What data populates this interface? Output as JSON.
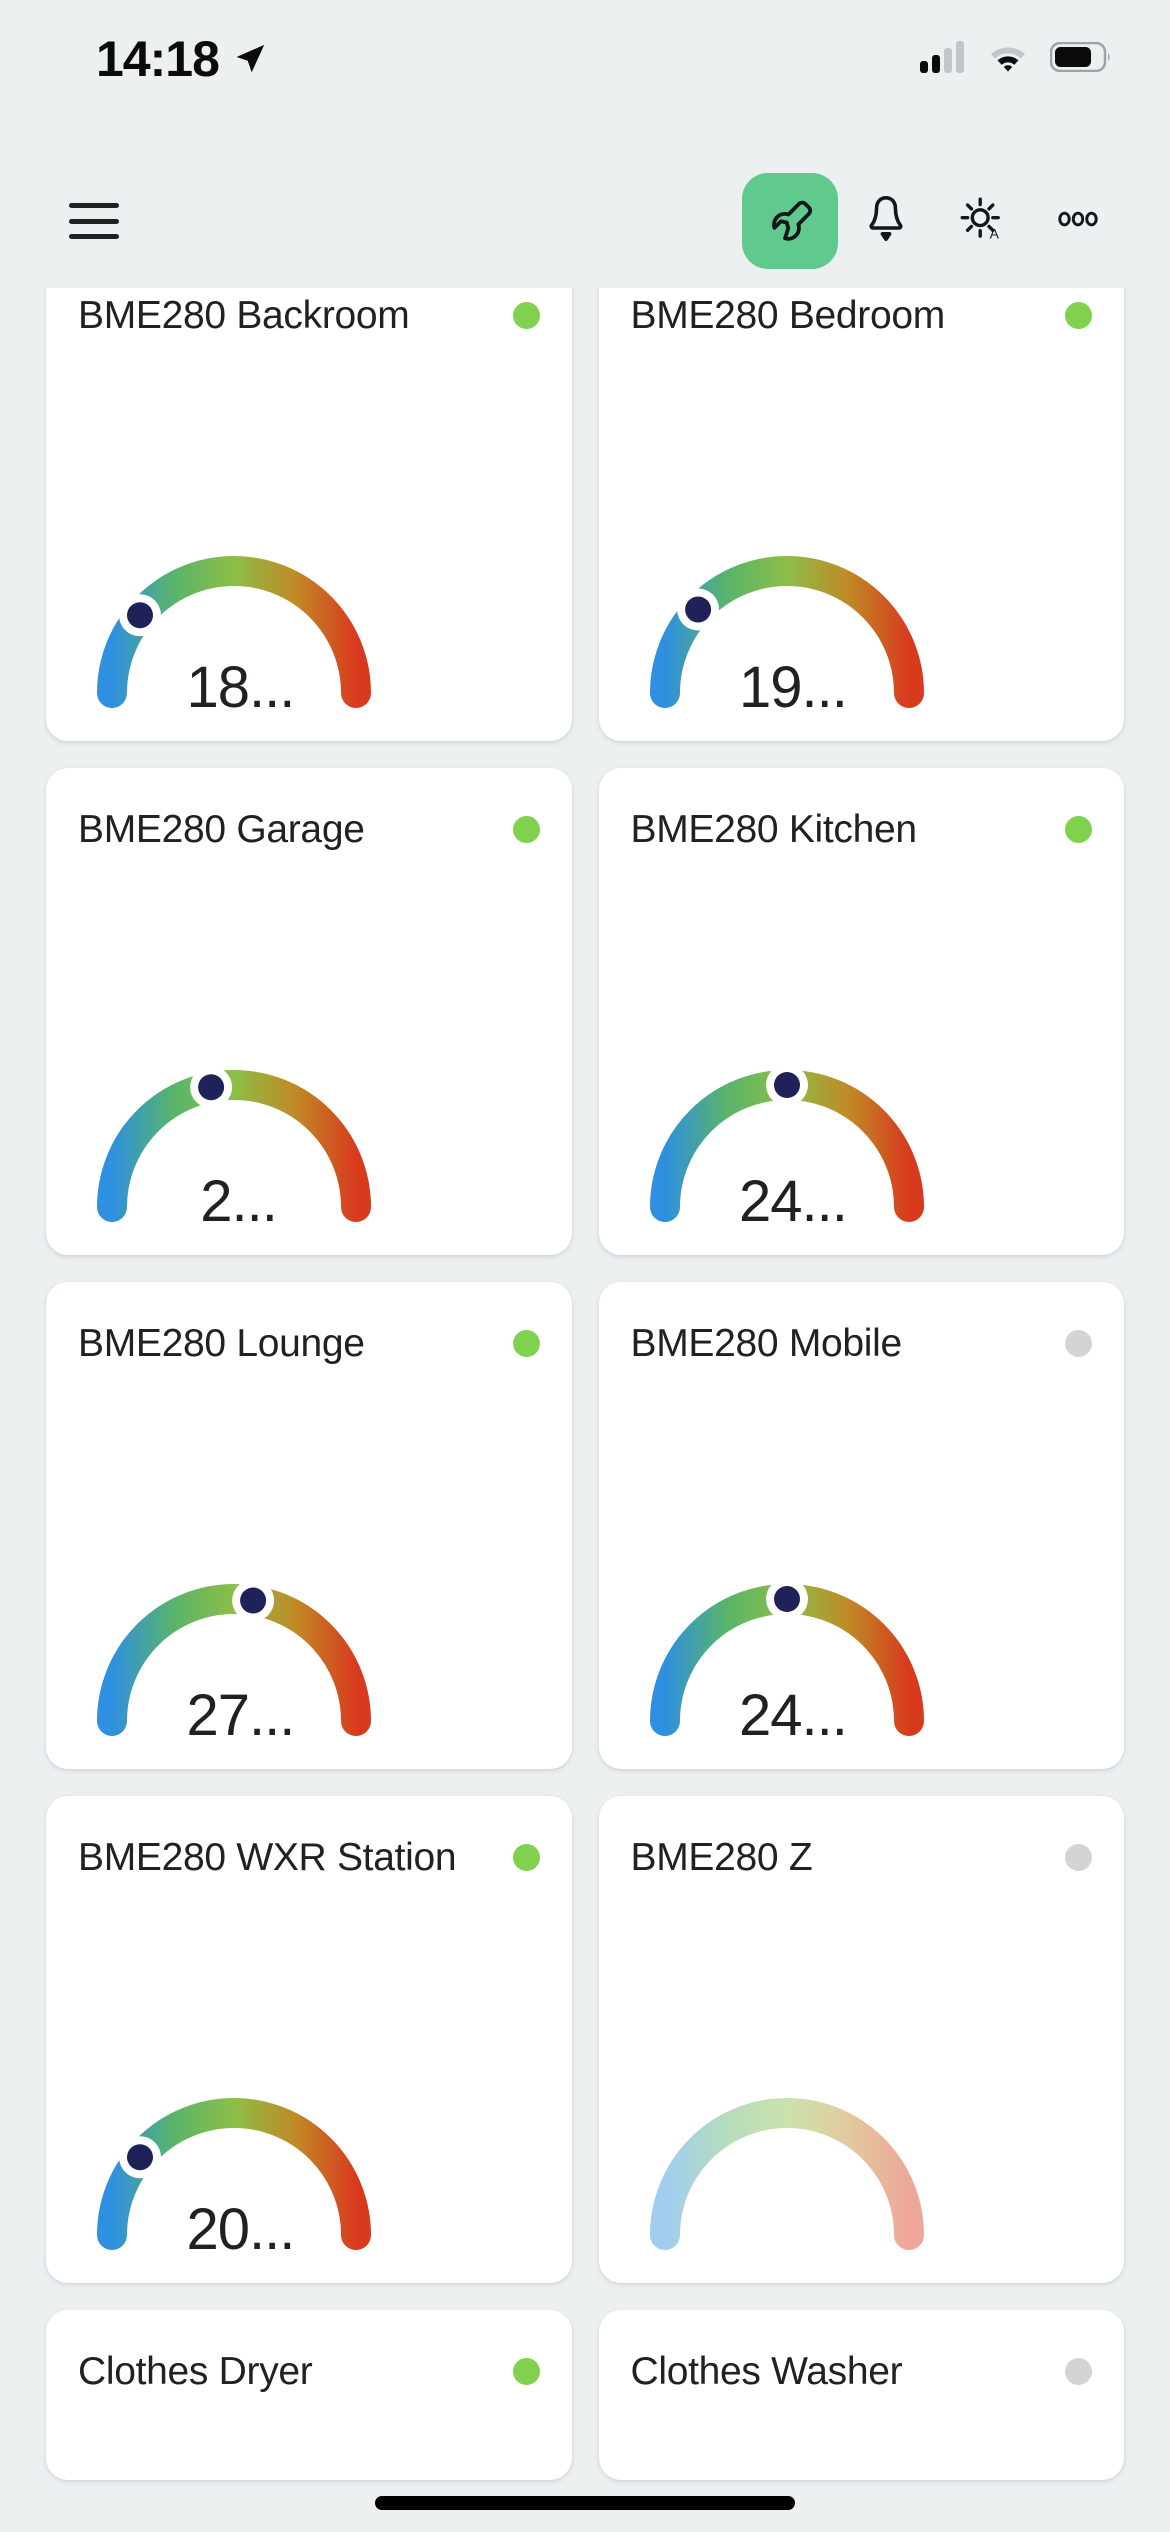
{
  "status_bar": {
    "time": "14:18",
    "location_icon": "location-arrow-icon",
    "cellular_icon": "cellular-signal-icon",
    "cellular_bars_filled": 2,
    "cellular_bars_total": 4,
    "wifi_icon": "wifi-icon",
    "battery_icon": "battery-icon",
    "battery_level_percent": 70
  },
  "toolbar": {
    "menu_icon": "hamburger-menu-icon",
    "actions": [
      {
        "name": "edit-dashboard-button",
        "icon": "wrench-icon",
        "active": true,
        "accent_color": "#5FC98E"
      },
      {
        "name": "notifications-button",
        "icon": "bell-icon",
        "active": false
      },
      {
        "name": "theme-brightness-button",
        "icon": "brightness-auto-icon",
        "active": false
      },
      {
        "name": "overflow-menu-button",
        "icon": "three-dots-icon",
        "active": false
      }
    ]
  },
  "colors": {
    "background": "#ECF0F1",
    "card": "#FFFFFF",
    "text": "#202124",
    "accent_green": "#5FC98E",
    "status_on": "#7FD14E",
    "status_off": "#D2D4D6",
    "gauge_needle": "#1E2258",
    "gauge_low": "#2F8FE0",
    "gauge_mid": "#6BB84B",
    "gauge_high": "#D83A1E"
  },
  "cards": [
    {
      "title": "BME280 Backroom",
      "status": "on",
      "value": "18...",
      "gauge_fraction": 0.22,
      "has_gauge": true,
      "available": true,
      "clipped_top": true
    },
    {
      "title": "BME280 Bedroom",
      "status": "on",
      "value": "19...",
      "gauge_fraction": 0.24,
      "has_gauge": true,
      "available": true,
      "clipped_top": true
    },
    {
      "title": "BME280 Garage",
      "status": "on",
      "value": "2...",
      "gauge_fraction": 0.44,
      "has_gauge": true,
      "available": true,
      "clipped_top": false
    },
    {
      "title": "BME280 Kitchen",
      "status": "on",
      "value": "24...",
      "gauge_fraction": 0.5,
      "has_gauge": true,
      "available": true,
      "clipped_top": false
    },
    {
      "title": "BME280 Lounge",
      "status": "on",
      "value": "27...",
      "gauge_fraction": 0.55,
      "has_gauge": true,
      "available": true,
      "clipped_top": false
    },
    {
      "title": "BME280 Mobile",
      "status": "off",
      "value": "24...",
      "gauge_fraction": 0.5,
      "has_gauge": true,
      "available": true,
      "clipped_top": false
    },
    {
      "title": "BME280 WXR Station",
      "status": "on",
      "value": "20...",
      "gauge_fraction": 0.22,
      "has_gauge": true,
      "available": true,
      "clipped_top": false
    },
    {
      "title": "BME280 Z",
      "status": "off",
      "value": "",
      "gauge_fraction": 0.0,
      "has_gauge": true,
      "available": false,
      "clipped_top": false
    },
    {
      "title": "Clothes Dryer",
      "status": "on",
      "value": "",
      "gauge_fraction": 0.0,
      "has_gauge": false,
      "available": true,
      "clipped_top": false
    },
    {
      "title": "Clothes Washer",
      "status": "off",
      "value": "",
      "gauge_fraction": 0.0,
      "has_gauge": false,
      "available": true,
      "clipped_top": false
    }
  ],
  "chart_data": {
    "type": "gauge",
    "title": "BME280 sensor gauges",
    "arc_degrees": 180,
    "series": [
      {
        "name": "BME280 Backroom",
        "value": "18...",
        "fraction": 0.22
      },
      {
        "name": "BME280 Bedroom",
        "value": "19...",
        "fraction": 0.24
      },
      {
        "name": "BME280 Garage",
        "value": "2...",
        "fraction": 0.44
      },
      {
        "name": "BME280 Kitchen",
        "value": "24...",
        "fraction": 0.5
      },
      {
        "name": "BME280 Lounge",
        "value": "27...",
        "fraction": 0.55
      },
      {
        "name": "BME280 Mobile",
        "value": "24...",
        "fraction": 0.5
      },
      {
        "name": "BME280 WXR Station",
        "value": "20...",
        "fraction": 0.22
      },
      {
        "name": "BME280 Z",
        "value": "",
        "fraction": null
      }
    ],
    "gradient_stops": [
      "#2F8FE0",
      "#58B46A",
      "#8CBE49",
      "#C08A26",
      "#D83A1E"
    ],
    "legend": "none",
    "grid": false
  }
}
